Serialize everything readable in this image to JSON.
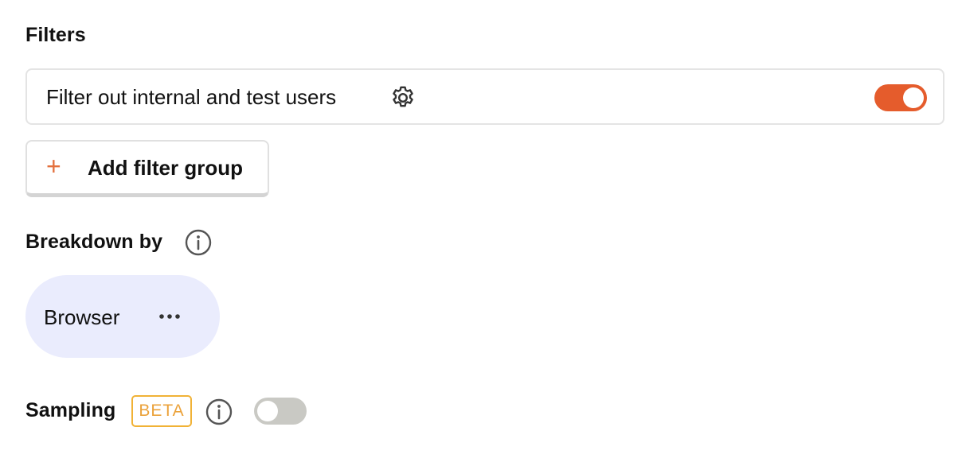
{
  "filters": {
    "title": "Filters",
    "test_users_filter": {
      "label": "Filter out internal and test users",
      "settings_icon": "gear-icon",
      "enabled": true
    },
    "add_filter_group": {
      "icon": "plus-icon",
      "label": "Add filter group"
    }
  },
  "breakdown": {
    "title": "Breakdown by",
    "info_icon": "info-icon",
    "items": [
      {
        "label": "Browser",
        "menu_icon": "more-horizontal-icon"
      }
    ]
  },
  "sampling": {
    "title": "Sampling",
    "badge": "BETA",
    "info_icon": "info-icon",
    "enabled": false
  },
  "colors": {
    "accent": "#e55c2c",
    "plus": "#e3703d",
    "pill_bg": "#eaecfd",
    "badge": "#f1b236",
    "toggle_off": "#c9c9c4",
    "border": "#e4e4e4"
  }
}
